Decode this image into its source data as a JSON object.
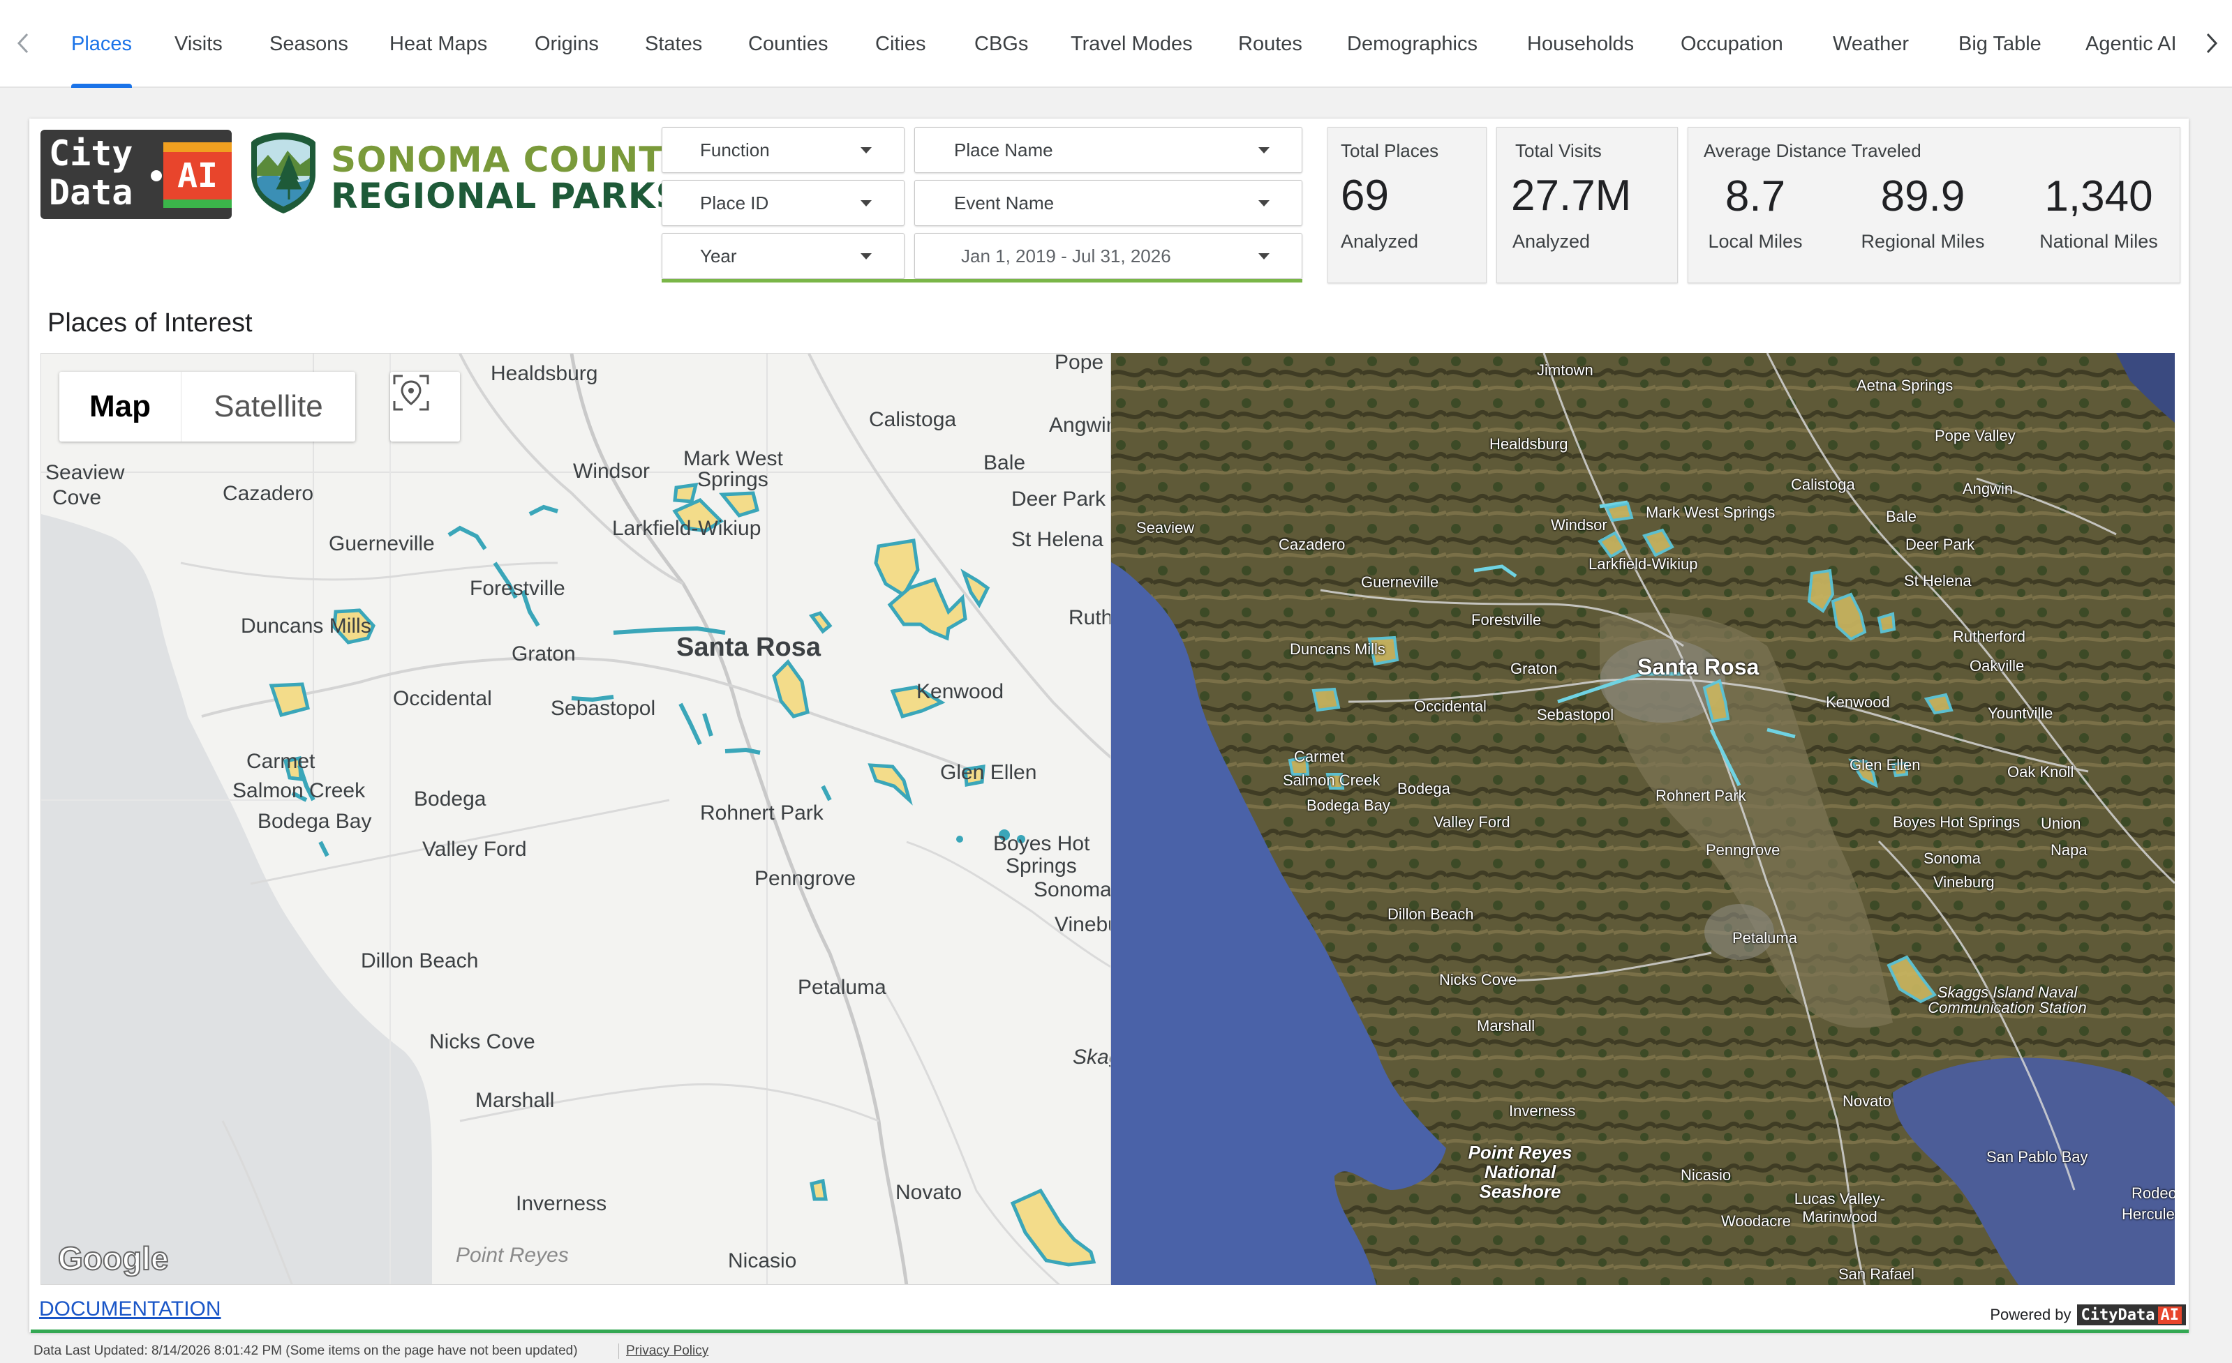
{
  "nav": {
    "tabs": [
      {
        "label": "Places"
      },
      {
        "label": "Visits"
      },
      {
        "label": "Seasons"
      },
      {
        "label": "Heat Maps"
      },
      {
        "label": "Origins"
      },
      {
        "label": "States"
      },
      {
        "label": "Counties"
      },
      {
        "label": "Cities"
      },
      {
        "label": "CBGs"
      },
      {
        "label": "Travel Modes"
      },
      {
        "label": "Routes"
      },
      {
        "label": "Demographics"
      },
      {
        "label": "Households"
      },
      {
        "label": "Occupation"
      },
      {
        "label": "Weather"
      },
      {
        "label": "Big Table"
      },
      {
        "label": "Agentic AI"
      }
    ],
    "active_tab": "Places"
  },
  "logos": {
    "citydata_line1": "City",
    "citydata_line2": "Data",
    "citydata_ai": "AI",
    "sonoma_line1": "SONOMA COUNTY",
    "sonoma_line2": "REGIONAL PARKS"
  },
  "filters": {
    "function": "Function",
    "place_name": "Place Name",
    "place_id": "Place ID",
    "event_name": "Event Name",
    "year": "Year",
    "date_range": "Jan 1, 2019 - Jul 31, 2026"
  },
  "scorecards": {
    "total_places": {
      "title": "Total Places",
      "value": "69",
      "sub": "Analyzed"
    },
    "total_visits": {
      "title": "Total Visits",
      "value": "27.7M",
      "sub": "Analyzed"
    },
    "avg_distance": {
      "title": "Average Distance Traveled",
      "local": {
        "value": "8.7",
        "label": "Local Miles"
      },
      "regional": {
        "value": "89.9",
        "label": "Regional Miles"
      },
      "national": {
        "value": "1,340",
        "label": "National Miles"
      }
    }
  },
  "section_title": "Places of Interest",
  "map": {
    "toggle_map": "Map",
    "toggle_satellite": "Satellite",
    "google": "Google",
    "colors": {
      "park_fill": "#f3dc8a",
      "park_stroke": "#3aa6b9",
      "water": "#5a73b8",
      "land": "#6e6a3f"
    },
    "left_labels": {
      "healdsburg": "Healdsburg",
      "pope": "Pope",
      "calistoga": "Calistoga",
      "angwin": "Angwin",
      "seaview": "Seaview",
      "cove": "Cove",
      "cazadero": "Cazadero",
      "windsor": "Windsor",
      "mark_west": "Mark West",
      "springs": "Springs",
      "bale": "Bale",
      "deer_park": "Deer Park",
      "guerneville": "Guerneville",
      "larkfield": "Larkfield-Wikiup",
      "st_helena": "St Helena",
      "forestville": "Forestville",
      "ruth": "Ruth",
      "duncans": "Duncans Mills",
      "graton": "Graton",
      "santa_rosa": "Santa Rosa",
      "occidental": "Occidental",
      "sebastopol": "Sebastopol",
      "kenwood": "Kenwood",
      "carmet": "Carmet",
      "salmon_creek": "Salmon Creek",
      "bodega": "Bodega",
      "bodega_bay": "Bodega Bay",
      "glen_ellen": "Glen Ellen",
      "rohnert_park": "Rohnert Park",
      "valley_ford": "Valley Ford",
      "boyes": "Boyes Hot",
      "boyes2": "Springs",
      "penngrove": "Penngrove",
      "sonoma": "Sonoma",
      "vineburg": "Vineburg",
      "dillon_beach": "Dillon Beach",
      "petaluma": "Petaluma",
      "nicks_cove": "Nicks Cove",
      "skaggs": "Skaggs Island",
      "marshall": "Marshall",
      "novato": "Novato",
      "inverness": "Inverness",
      "point_reyes": "Point Reyes",
      "nicasio": "Nicasio"
    },
    "right_labels": {
      "jimtown": "Jimtown",
      "aetna": "Aetna Springs",
      "pope_valley": "Pope Valley",
      "healdsburg": "Healdsburg",
      "calistoga": "Calistoga",
      "angwin": "Angwin",
      "seaview": "Seaview",
      "bale": "Bale",
      "deer_park": "Deer Park",
      "windsor": "Windsor",
      "mark_west": "Mark West Springs",
      "larkfield": "Larkfield-Wikiup",
      "cazadero": "Cazadero",
      "st_helena": "St Helena",
      "guerneville": "Guerneville",
      "rutherford": "Rutherford",
      "forestville": "Forestville",
      "oakville": "Oakville",
      "duncans": "Duncans Mills",
      "santa_rosa": "Santa Rosa",
      "graton": "Graton",
      "yountville": "Yountville",
      "kenwood": "Kenwood",
      "occidental": "Occidental",
      "sebastopol": "Sebastopol",
      "carmet": "Carmet",
      "salmon_creek": "Salmon Creek",
      "bodega": "Bodega",
      "bodega_bay": "Bodega Bay",
      "glen_ellen": "Glen Ellen",
      "oak_knoll": "Oak Knoll",
      "rohnert_park": "Rohnert Park",
      "valley_ford": "Valley Ford",
      "boyes": "Boyes Hot Springs",
      "union": "Union",
      "sonoma": "Sonoma",
      "napa": "Napa",
      "penngrove": "Penngrove",
      "vineburg": "Vineburg",
      "dillon_beach": "Dillon Beach",
      "petaluma": "Petaluma",
      "nicks_cove": "Nicks Cove",
      "skaggs": "Skaggs Island Naval Communication Station",
      "marshall": "Marshall",
      "inverness": "Inverness",
      "novato": "Novato",
      "san_pablo": "San Pablo Bay",
      "point_reyes": "Point Reyes National Seashore",
      "nicasio": "Nicasio",
      "lucas": "Lucas Valley-Marinwood",
      "woodacre": "Woodacre",
      "san_rafael": "San Rafael",
      "rodeo": "Rodeo",
      "hercules": "Hercules"
    }
  },
  "footer": {
    "documentation": "DOCUMENTATION",
    "powered_by": "Powered by",
    "powered_badge": "CityData",
    "powered_ai": "AI",
    "last_updated": "Data Last Updated: 8/14/2026 8:01:42 PM (Some items on the page have not been updated)",
    "privacy": "Privacy Policy"
  }
}
